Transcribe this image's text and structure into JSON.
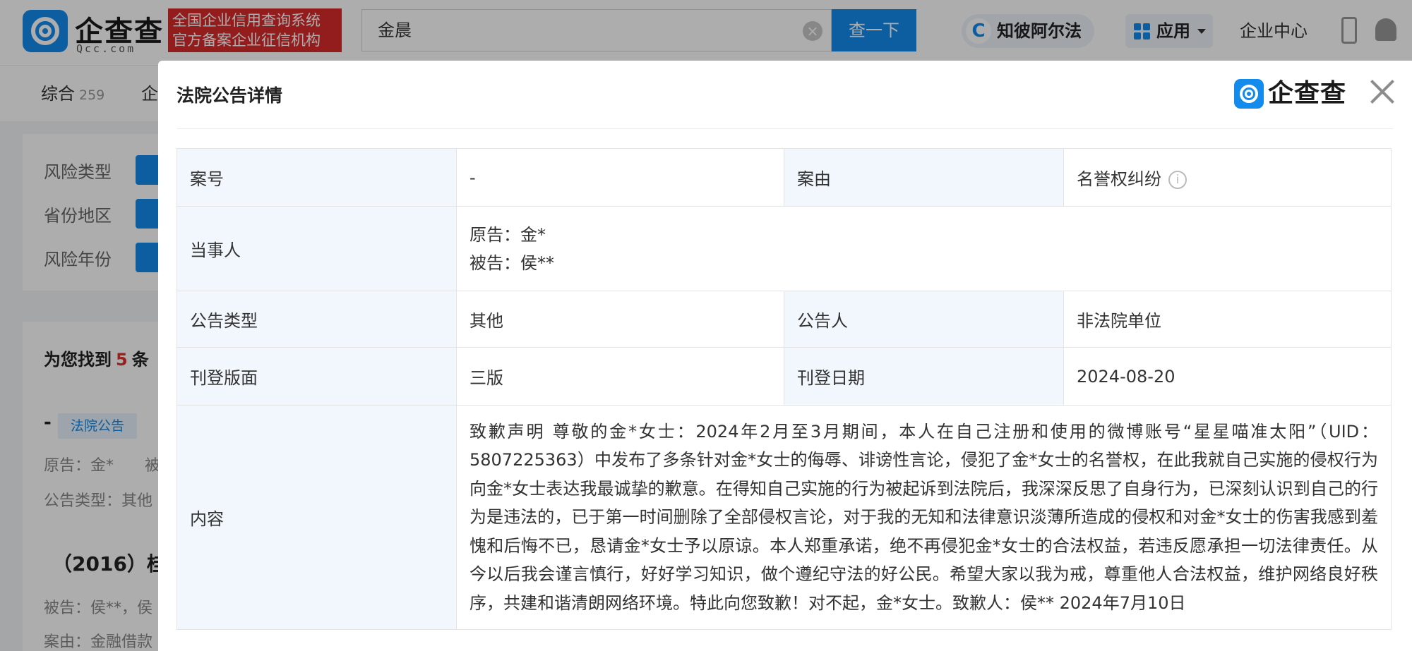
{
  "header": {
    "logo_text": "企查查",
    "logo_sub": "Qcc.com",
    "badge_line1": "全国企业信用查询系统",
    "badge_line2": "官方备案企业征信机构",
    "search_value": "金晨",
    "search_button": "查一下",
    "zhibi_label": "知彼阿尔法",
    "app_label": "应用",
    "enterprise_center": "企业中心"
  },
  "nav": {
    "tab_all": "综合",
    "tab_all_count": "259",
    "tab_other": "企"
  },
  "filters": {
    "risk_type": "风险类型",
    "region": "省份地区",
    "risk_year": "风险年份"
  },
  "results": {
    "found_prefix": "为您找到",
    "found_count": "5",
    "found_suffix": "条",
    "item_dash": "-",
    "item_tag": "法院公告",
    "line1": "原告：金*　　被",
    "line2": "公告类型：其他",
    "item2_title": "（2016）桂",
    "line3": "被告：侯**，侯",
    "line4": "案由：金融借款"
  },
  "modal": {
    "title": "法院公告详情",
    "logo_text": "企查查",
    "rows": {
      "case_no_label": "案号",
      "case_no_value": "-",
      "cause_label": "案由",
      "cause_value": "名誉权纠纷",
      "parties_label": "当事人",
      "plaintiff": "原告：金*",
      "defendant": "被告：侯**",
      "type_label": "公告类型",
      "type_value": "其他",
      "announcer_label": "公告人",
      "announcer_value": "非法院单位",
      "page_label": "刊登版面",
      "page_value": "三版",
      "date_label": "刊登日期",
      "date_value": "2024-08-20",
      "content_label": "内容",
      "content_value": "致歉声明 尊敬的金*女士：2024年2月至3月期间，本人在自己注册和使用的微博账号“星星喵准太阳”（UID：5807225363）中发布了多条针对金*女士的侮辱、诽谤性言论，侵犯了金*女士的名誉权，在此我就自己实施的侵权行为向金*女士表达我最诚挚的歉意。在得知自己实施的行为被起诉到法院后，我深深反思了自身行为，已深刻认识到自己的行为是违法的，已于第一时间删除了全部侵权言论，对于我的无知和法律意识淡薄所造成的侵权和对金*女士的伤害我感到羞愧和后悔不已，恳请金*女士予以原谅。本人郑重承诺，绝不再侵犯金*女士的合法权益，若违反愿承担一切法律责任。从今以后我会谨言慎行，好好学习知识，做个遵纪守法的好公民。希望大家以我为戒，尊重他人合法权益，维护网络良好秩序，共建和谐清朗网络环境。特此向您致歉！对不起，金*女士。致歉人：侯** 2024年7月10日"
    }
  },
  "colors": {
    "brand_blue": "#128bed",
    "badge_red": "#d92b2b",
    "label_bg": "#f1f7fc"
  }
}
